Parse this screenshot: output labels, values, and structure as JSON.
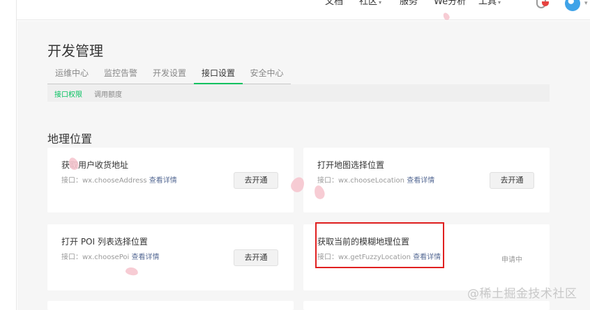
{
  "topnav": {
    "items": [
      {
        "label": "文档",
        "caret": false
      },
      {
        "label": "社区",
        "caret": true
      },
      {
        "label": "服务",
        "caret": false
      },
      {
        "label": "We分析",
        "caret": false
      },
      {
        "label": "工具",
        "caret": true
      }
    ]
  },
  "page_title": "开发管理",
  "tabs": [
    {
      "label": "运维中心",
      "active": false
    },
    {
      "label": "监控告警",
      "active": false
    },
    {
      "label": "开发设置",
      "active": false
    },
    {
      "label": "接口设置",
      "active": true
    },
    {
      "label": "安全中心",
      "active": false
    }
  ],
  "subtabs": [
    {
      "label": "接口权限",
      "active": true
    },
    {
      "label": "调用额度",
      "active": false
    }
  ],
  "section_title": "地理位置",
  "cards": [
    {
      "title": "获取用户收货地址",
      "api_prefix": "接口：",
      "api": "wx.chooseAddress",
      "link": "查看详情",
      "action": "去开通"
    },
    {
      "title": "打开地图选择位置",
      "api_prefix": "接口：",
      "api": "wx.chooseLocation",
      "link": "查看详情",
      "action": "去开通"
    },
    {
      "title": "打开 POI 列表选择位置",
      "api_prefix": "接口：",
      "api": "wx.choosePoi",
      "link": "查看详情",
      "action": "去开通"
    },
    {
      "title": "获取当前的模糊地理位置",
      "api_prefix": "接口：",
      "api": "wx.getFuzzyLocation",
      "link": "查看详情",
      "status": "申请中"
    }
  ],
  "watermark": "@稀土掘金技术社区",
  "colors": {
    "accent_green": "#07c160",
    "link_blue": "#576b95",
    "highlight_red": "#e02020",
    "background": "#f6f6f6"
  }
}
